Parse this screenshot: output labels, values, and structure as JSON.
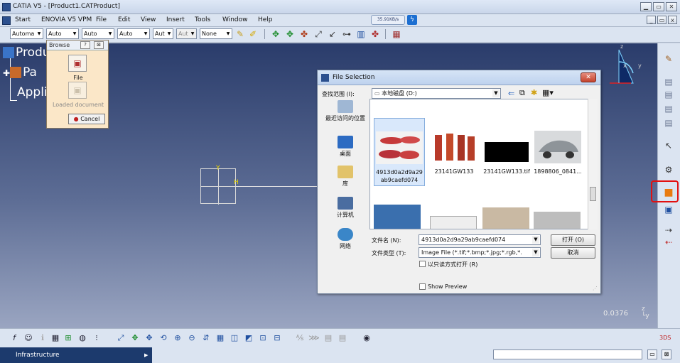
{
  "window": {
    "title": "CATIA V5 - [Product1.CATProduct]"
  },
  "menubar": {
    "items": [
      "Start",
      "ENOVIA V5 VPM",
      "File",
      "Edit",
      "View",
      "Insert",
      "Tools",
      "Window",
      "Help"
    ],
    "speed": "35.91KB/s"
  },
  "toolbar": {
    "combos": [
      "Automa",
      "Auto",
      "Auto",
      "Auto",
      "Aut",
      "Aut",
      "None"
    ]
  },
  "tree": {
    "nodes": [
      "Produ",
      "Pa",
      "Applic"
    ]
  },
  "browse": {
    "title": "Browse",
    "help": "?",
    "close": "⊠",
    "file_label": "File",
    "loaded_label": "Loaded document",
    "cancel_label": "Cancel"
  },
  "gizmo": {
    "y_label": "Y",
    "h_label": "H"
  },
  "compass": {
    "z": "z",
    "x": "x",
    "y": "y"
  },
  "viewport": {
    "zoom": "0.0376",
    "axis_z": "z",
    "axis_y": "y"
  },
  "dialog": {
    "title": "File Selection",
    "lookin_label": "查找范围 (I):",
    "lookin_value": "本地磁盘 (D:)",
    "places": [
      "最近访问的位置",
      "桌面",
      "库",
      "计算机",
      "网络"
    ],
    "files": [
      {
        "name": "4913d0a2d9a29ab9caefd074",
        "selected": true
      },
      {
        "name": "23141GW133",
        "selected": false
      },
      {
        "name": "23141GW133.tif",
        "selected": false
      },
      {
        "name": "1898806_0841...",
        "selected": false
      }
    ],
    "filename_label": "文件名 (N):",
    "filename_value": "4913d0a2d9a29ab9caefd074",
    "filetype_label": "文件类型 (T):",
    "filetype_value": "Image File (*.tif;*.bmp;*.jpg;*.rgb,*.",
    "readonly_label": "以只读方式打开 (R)",
    "preview_label": "Show Preview",
    "open_label": "打开 (O)",
    "cancel_label": "取消"
  },
  "status": {
    "workbench": "Infrastructure"
  }
}
